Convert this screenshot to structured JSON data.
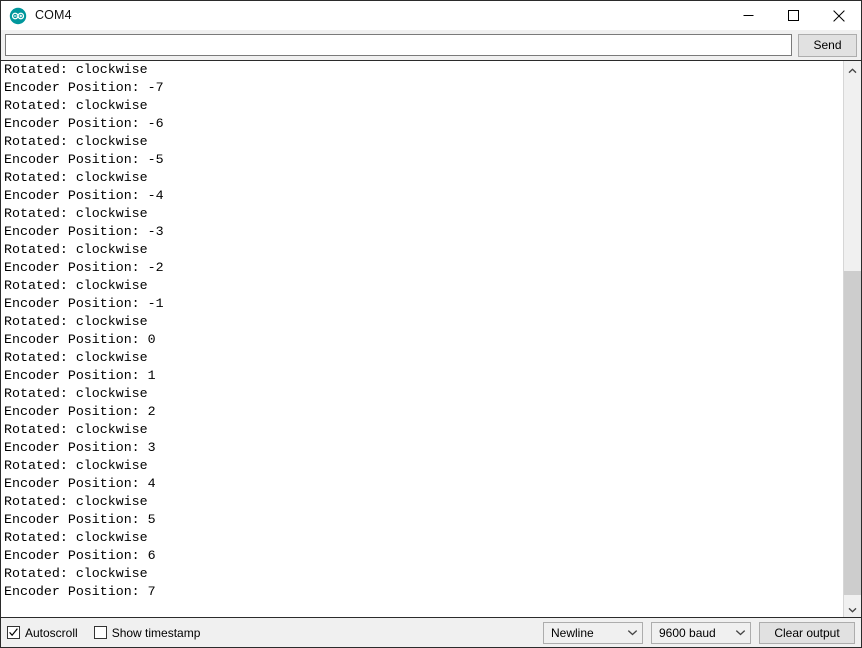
{
  "window": {
    "title": "COM4",
    "app_icon": "arduino-infinity-icon",
    "controls": {
      "minimize": "minimize-icon",
      "maximize": "maximize-icon",
      "close": "close-icon"
    }
  },
  "send_bar": {
    "input_value": "",
    "input_placeholder": "",
    "send_label": "Send"
  },
  "output": {
    "lines": [
      "Rotated: clockwise",
      "Encoder Position: -7",
      "Rotated: clockwise",
      "Encoder Position: -6",
      "Rotated: clockwise",
      "Encoder Position: -5",
      "Rotated: clockwise",
      "Encoder Position: -4",
      "Rotated: clockwise",
      "Encoder Position: -3",
      "Rotated: clockwise",
      "Encoder Position: -2",
      "Rotated: clockwise",
      "Encoder Position: -1",
      "Rotated: clockwise",
      "Encoder Position: 0",
      "Rotated: clockwise",
      "Encoder Position: 1",
      "Rotated: clockwise",
      "Encoder Position: 2",
      "Rotated: clockwise",
      "Encoder Position: 3",
      "Rotated: clockwise",
      "Encoder Position: 4",
      "Rotated: clockwise",
      "Encoder Position: 5",
      "Rotated: clockwise",
      "Encoder Position: 6",
      "Rotated: clockwise",
      "Encoder Position: 7"
    ]
  },
  "scrollbar": {
    "up_arrow": "chevron-up-icon",
    "down_arrow": "chevron-down-icon",
    "thumb_top_pct": 37,
    "thumb_height_pct": 62
  },
  "status_bar": {
    "autoscroll": {
      "label": "Autoscroll",
      "checked": true
    },
    "show_timestamp": {
      "label": "Show timestamp",
      "checked": false
    },
    "line_ending": {
      "selected": "Newline"
    },
    "baud_rate": {
      "selected": "9600 baud"
    },
    "clear_label": "Clear output"
  },
  "colors": {
    "accent": "#00979c",
    "window_bg": "#f0f0f0",
    "text_bg": "#ffffff",
    "border": "#2b2b2b",
    "thumb": "#cdcdcd"
  }
}
